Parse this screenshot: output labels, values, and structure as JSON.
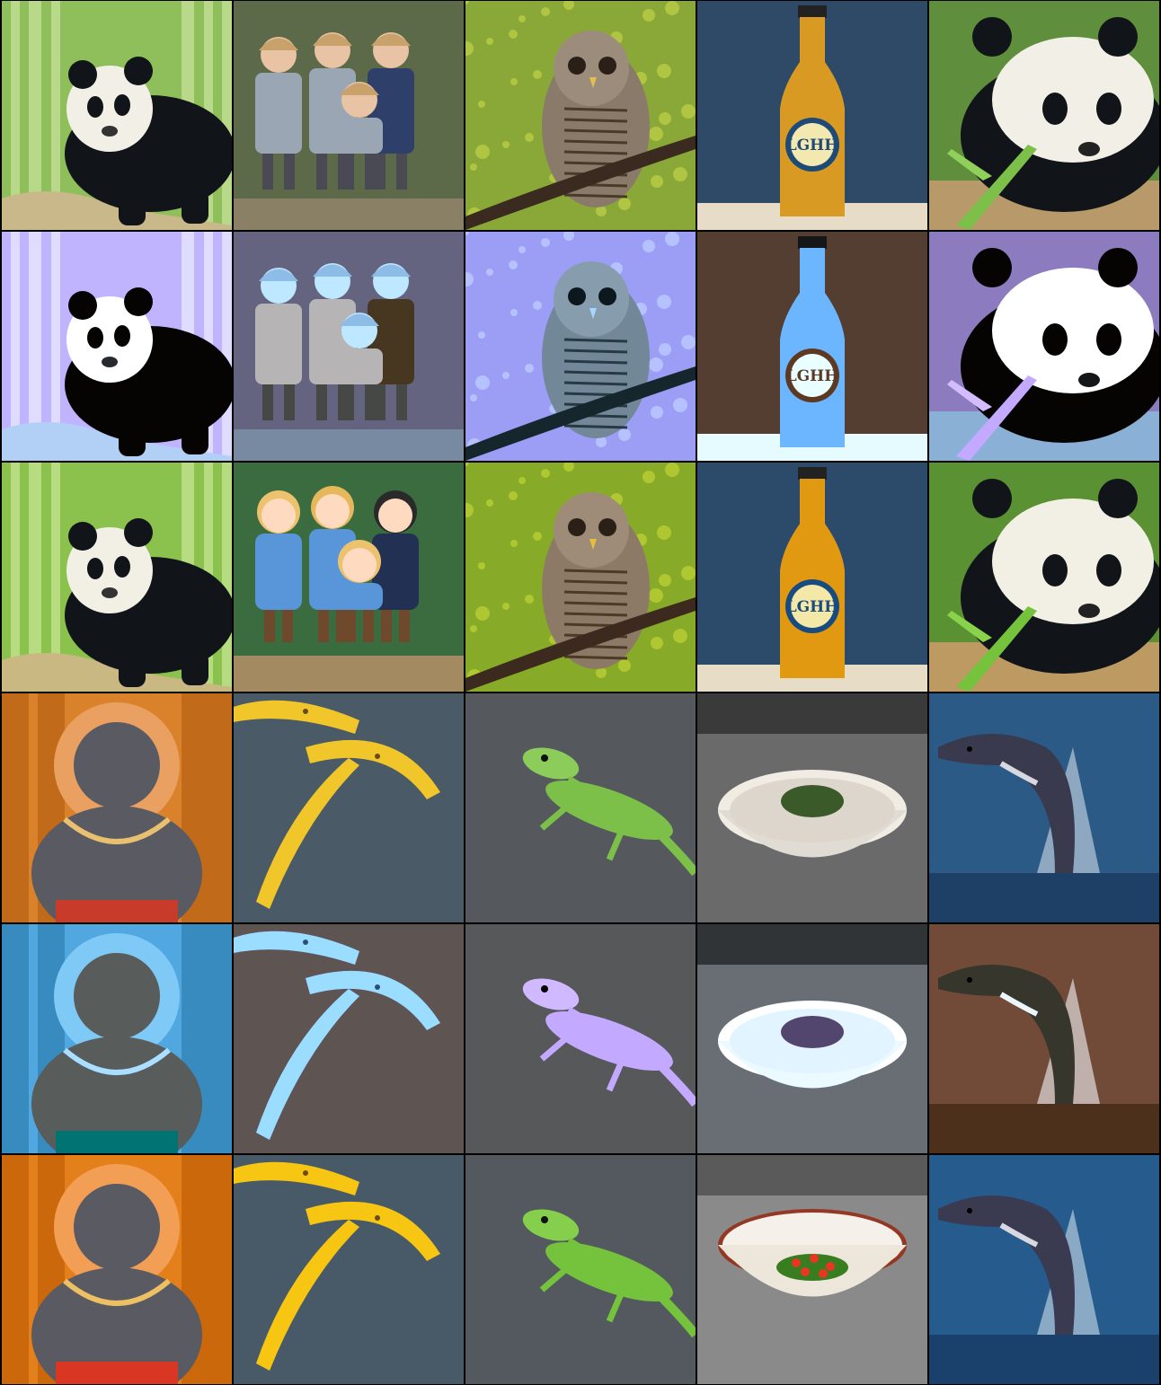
{
  "grid": {
    "rows": 6,
    "cols": 5,
    "tiles": [
      {
        "row": 1,
        "col": 1,
        "subject": "panda-in-bamboo",
        "variant": "original"
      },
      {
        "row": 1,
        "col": 2,
        "subject": "children-painting",
        "variant": "original"
      },
      {
        "row": 1,
        "col": 3,
        "subject": "barred-owl",
        "variant": "original"
      },
      {
        "row": 1,
        "col": 4,
        "subject": "beer-bottle",
        "variant": "original"
      },
      {
        "row": 1,
        "col": 5,
        "subject": "panda-eating",
        "variant": "original"
      },
      {
        "row": 2,
        "col": 1,
        "subject": "panda-in-bamboo",
        "variant": "degraded"
      },
      {
        "row": 2,
        "col": 2,
        "subject": "children-painting",
        "variant": "degraded"
      },
      {
        "row": 2,
        "col": 3,
        "subject": "barred-owl",
        "variant": "degraded"
      },
      {
        "row": 2,
        "col": 4,
        "subject": "beer-bottle",
        "variant": "degraded"
      },
      {
        "row": 2,
        "col": 5,
        "subject": "panda-eating",
        "variant": "degraded"
      },
      {
        "row": 3,
        "col": 1,
        "subject": "panda-in-bamboo",
        "variant": "restored"
      },
      {
        "row": 3,
        "col": 2,
        "subject": "children-anime",
        "variant": "restored"
      },
      {
        "row": 3,
        "col": 3,
        "subject": "barred-owl",
        "variant": "restored"
      },
      {
        "row": 3,
        "col": 4,
        "subject": "beer-bottle",
        "variant": "restored"
      },
      {
        "row": 3,
        "col": 5,
        "subject": "panda-eating",
        "variant": "restored"
      },
      {
        "row": 4,
        "col": 1,
        "subject": "hanuman-statue",
        "variant": "original"
      },
      {
        "row": 4,
        "col": 2,
        "subject": "bananas",
        "variant": "original"
      },
      {
        "row": 4,
        "col": 3,
        "subject": "green-lizard",
        "variant": "original"
      },
      {
        "row": 4,
        "col": 4,
        "subject": "bowl-with-herbs",
        "variant": "original"
      },
      {
        "row": 4,
        "col": 5,
        "subject": "jumping-dolphin",
        "variant": "original"
      },
      {
        "row": 5,
        "col": 1,
        "subject": "hanuman-statue",
        "variant": "degraded"
      },
      {
        "row": 5,
        "col": 2,
        "subject": "bananas",
        "variant": "degraded"
      },
      {
        "row": 5,
        "col": 3,
        "subject": "green-lizard",
        "variant": "degraded"
      },
      {
        "row": 5,
        "col": 4,
        "subject": "bowl-with-herbs",
        "variant": "degraded"
      },
      {
        "row": 5,
        "col": 5,
        "subject": "jumping-dolphin",
        "variant": "degraded"
      },
      {
        "row": 6,
        "col": 1,
        "subject": "hanuman-statue",
        "variant": "restored"
      },
      {
        "row": 6,
        "col": 2,
        "subject": "bananas",
        "variant": "restored"
      },
      {
        "row": 6,
        "col": 3,
        "subject": "green-lizard",
        "variant": "restored"
      },
      {
        "row": 6,
        "col": 4,
        "subject": "bowl-with-salad",
        "variant": "restored"
      },
      {
        "row": 6,
        "col": 5,
        "subject": "jumping-dolphin",
        "variant": "restored"
      }
    ]
  },
  "bottle_label": {
    "text": "LGHH"
  },
  "colors": {
    "bamboo_green": "#8fbf5a",
    "panda_black": "#111418",
    "panda_white": "#f2f0e6",
    "owl_bg": "#8aa838",
    "bottle_bg": "#2f4a66",
    "beer_amber": "#d99a24",
    "banana_yellow": "#f0c62a",
    "slate_bg": "#4a5a66",
    "sea_blue": "#2c5a86",
    "temple_orange": "#d9822b"
  }
}
